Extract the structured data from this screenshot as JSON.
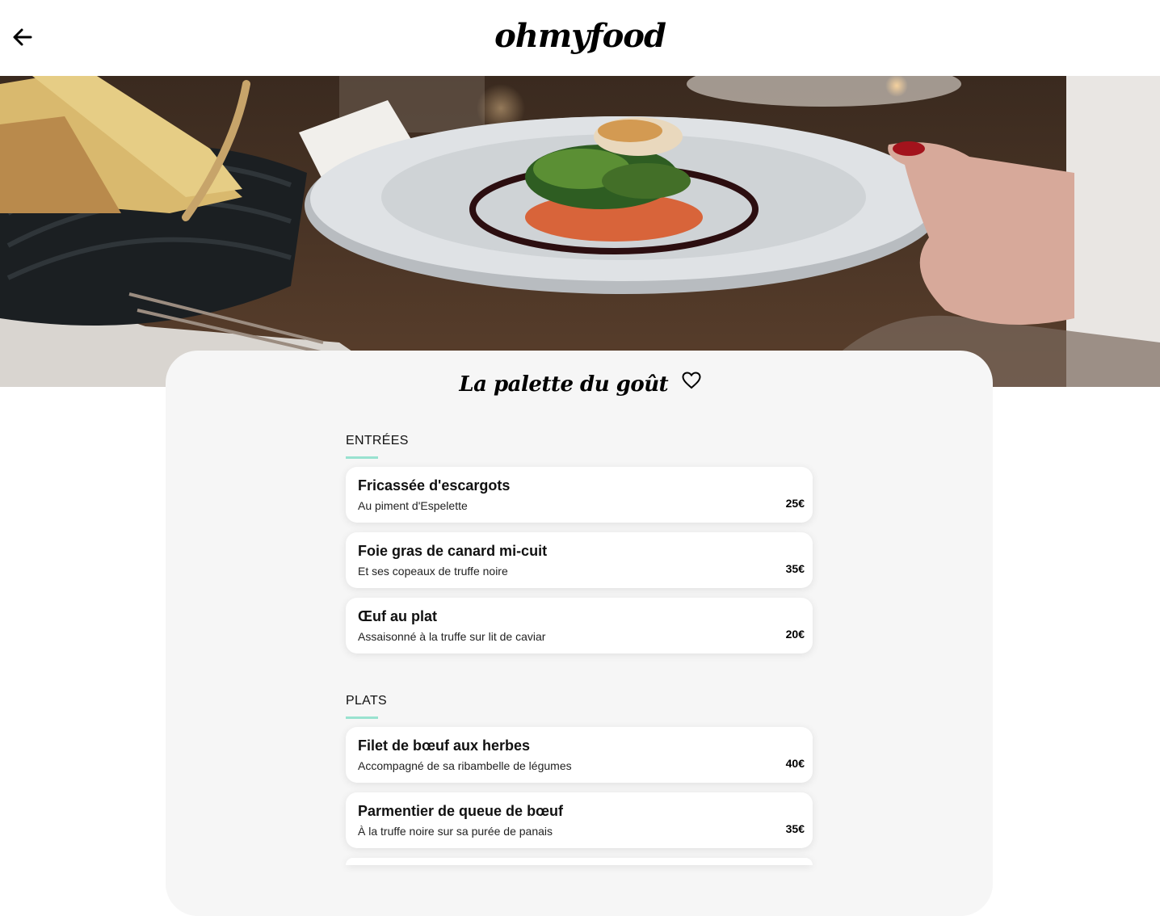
{
  "header": {
    "logo": "ohmyfood",
    "back_icon": "arrow-left-icon"
  },
  "hero": {
    "alt": "plated fish dish on a white plate"
  },
  "restaurant": {
    "name": "La palette du goût",
    "favorite_icon": "heart-outline-icon"
  },
  "menu": {
    "sections": [
      {
        "title": "ENTRÉES",
        "dishes": [
          {
            "name": "Fricassée d'escargots",
            "desc": "Au piment d'Espelette",
            "price": "25€"
          },
          {
            "name": "Foie gras de canard mi-cuit",
            "desc": "Et ses copeaux de truffe noire",
            "price": "35€"
          },
          {
            "name": "Œuf au plat",
            "desc": "Assaisonné à la truffe sur lit de caviar",
            "price": "20€"
          }
        ]
      },
      {
        "title": "PLATS",
        "dishes": [
          {
            "name": "Filet de bœuf aux herbes",
            "desc": "Accompagné de sa ribambelle de légumes",
            "price": "40€"
          },
          {
            "name": "Parmentier de queue de bœuf",
            "desc": "À la truffe noire sur sa purée de panais",
            "price": "35€"
          }
        ]
      }
    ]
  },
  "colors": {
    "accent": "#99e2d0",
    "card_bg": "#f6f6f6"
  }
}
